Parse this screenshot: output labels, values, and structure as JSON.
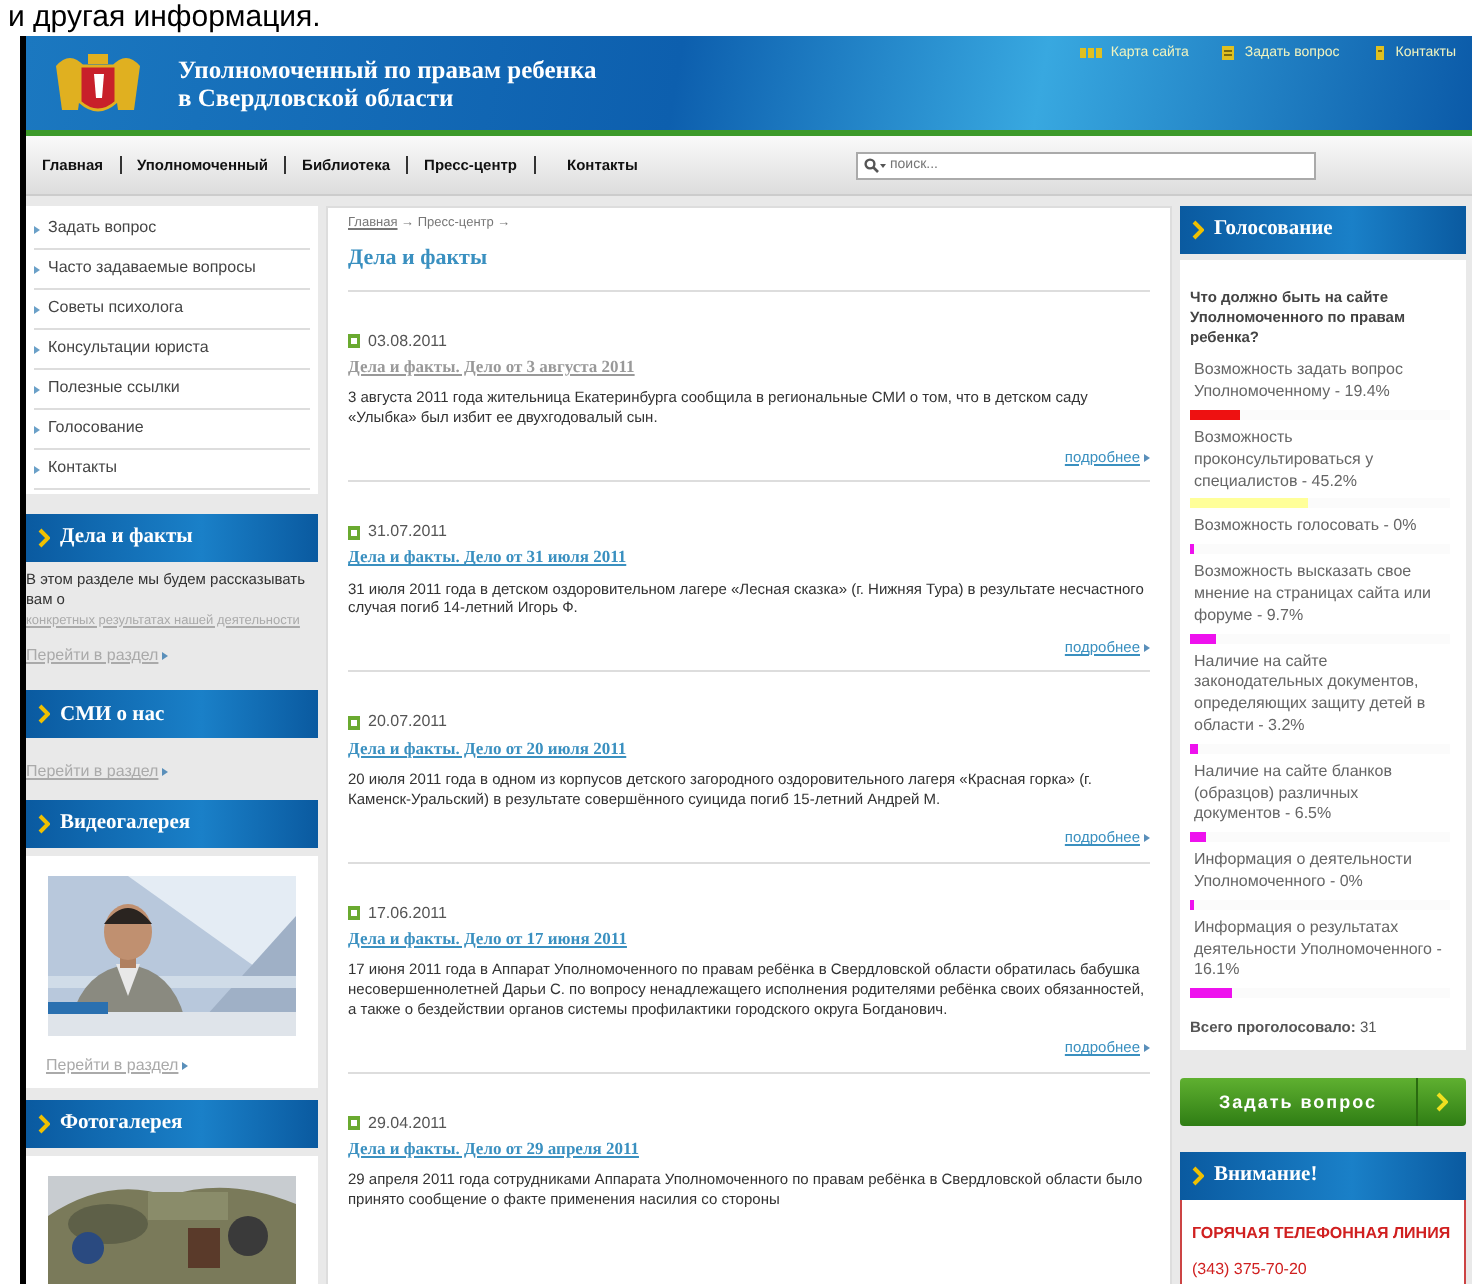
{
  "caption": "и другая информация.",
  "header": {
    "title_lines": [
      "Уполномоченный по правам ребенка",
      "в Свердловской области"
    ],
    "links": [
      {
        "kind": "sitemap",
        "label": "Карта сайта"
      },
      {
        "kind": "question",
        "label": "Задать вопрос"
      },
      {
        "kind": "contacts",
        "label": "Контакты"
      }
    ]
  },
  "nav": {
    "items": [
      "Главная",
      "Уполномоченный",
      "Библиотека",
      "Пресс-центр",
      "Контакты"
    ],
    "search": {
      "placeholder": "поиск..."
    }
  },
  "sidebar": {
    "menu": [
      "Задать вопрос",
      "Часто задаваемые вопросы",
      "Советы психолога",
      "Консультации юриста",
      "Полезные ссылки",
      "Голосование",
      "Контакты"
    ],
    "blocks": [
      {
        "kind": "text",
        "title": "Дела и факты",
        "text": "В этом разделе мы будем рассказывать вам о",
        "link": "конкретных результатах нашей деятельности",
        "more": "Перейти в раздел"
      },
      {
        "kind": "plain",
        "title": "СМИ о нас",
        "more": "Перейти в раздел"
      },
      {
        "kind": "picture",
        "title": "Видеогалерея",
        "more": "Перейти в раздел"
      },
      {
        "kind": "picture",
        "title": "Фотогалерея"
      }
    ]
  },
  "main": {
    "breadcrumb": {
      "link": "Главная",
      "rest": "→ Пресс-центр →"
    },
    "title": "Дела и факты",
    "articles": [
      {
        "date": "03.08.2011",
        "title": "Дела и факты. Дело от 3 августа 2011",
        "visited": true,
        "text": "3 августа 2011 года жительница Екатеринбурга сообщила в региональные СМИ о том, что в детском саду «Улыбка» был избит ее двухгодовалый сын.",
        "more": "подробнее"
      },
      {
        "date": "31.07.2011",
        "title": "Дела и факты. Дело от 31 июля 2011",
        "visited": false,
        "text": "31 июля 2011 года в детском оздоровительном лагере «Лесная сказка» (г. Нижняя Тура) в результате несчастного случая погиб 14-летний Игорь Ф.",
        "more": "подробнее"
      },
      {
        "date": "20.07.2011",
        "title": "Дела и факты. Дело от 20 июля 2011",
        "visited": false,
        "text": "20 июля 2011 года в одном из корпусов детского загородного оздоровительного лагеря «Красная горка» (г. Каменск-Уральский) в результате совершённого суицида погиб 15-летний Андрей М.",
        "more": "подробнее"
      },
      {
        "date": "17.06.2011",
        "title": "Дела и факты. Дело от 17 июня 2011",
        "visited": false,
        "text": "17 июня 2011 года в Аппарат Уполномоченного по правам ребёнка в Свердловской области обратилась бабушка несовершеннолетней Дарьи С. по вопросу ненадлежащего исполнения родителями ребёнка своих обязанностей, а также о бездействии органов системы профилактики городского округа Богданович.",
        "more": "подробнее"
      },
      {
        "date": "29.04.2011",
        "title": "Дела и факты. Дело от 29 апреля 2011",
        "visited": false,
        "text": "29 апреля 2011 года сотрудниками Аппарата Уполномоченного по правам ребёнка в Свердловской области было принято сообщение о факте применения насилия со стороны"
      }
    ]
  },
  "poll": {
    "title": "Голосование",
    "question": "Что должно быть на сайте Уполномоченного по правам ребенка?",
    "options": [
      {
        "label": "Возможность задать вопрос Уполномоченному - 19.4%",
        "level": 0.194,
        "color": "#ee1111"
      },
      {
        "label": "Возможность проконсультироваться у специалистов - 45.2%",
        "level": 0.452,
        "color": "#ffff99"
      },
      {
        "label": "Возможность голосовать - 0%",
        "level": 0,
        "color": "#ee11ee"
      },
      {
        "label": "Возможность высказать свое мнение на страницах сайта или форуме - 9.7%",
        "level": 0.097,
        "color": "#ee11ee"
      },
      {
        "label": "Наличие на сайте законодательных документов, определяющих защиту детей в области - 3.2%",
        "level": 0.032,
        "color": "#ee11ee"
      },
      {
        "label": "Наличие на сайте бланков (образцов) различных документов - 6.5%",
        "level": 0.065,
        "color": "#ee11ee"
      },
      {
        "label": "Информация о деятельности Уполномоченного - 0%",
        "level": 0,
        "color": "#ee11ee"
      },
      {
        "label": "Информация о результатах деятельности Уполномоченного - 16.1%",
        "level": 0.161,
        "color": "#ee11ee"
      }
    ],
    "total_label": "Всего проголосовало:",
    "total": "31"
  },
  "ask_button": {
    "label": "Задать вопрос"
  },
  "attention": {
    "title": "Внимание!",
    "hotline": "ГОРЯЧАЯ ТЕЛЕФОННАЯ ЛИНИЯ",
    "phone": "(343) 375-70-20"
  }
}
